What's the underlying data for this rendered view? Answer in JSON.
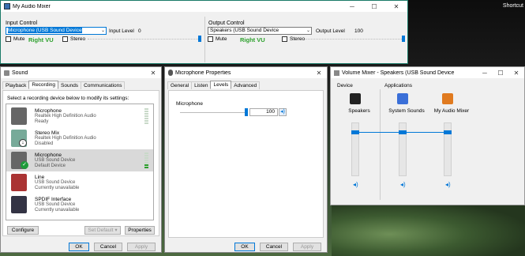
{
  "desktop": {
    "shortcut_label": "Shortcut"
  },
  "mixer": {
    "title": "My Audio Mixer",
    "input": {
      "group_label": "Input Control",
      "device_value": "Microphone (USB Sound Device",
      "level_label": "Input Level",
      "level_value": "0",
      "mute_label": "Mute",
      "vu_label": "Right VU",
      "stereo_label": "Stereo",
      "slider_fraction": 1.0
    },
    "output": {
      "group_label": "Output Control",
      "device_value": "Speakers (USB Sound Device",
      "level_label": "Output Level",
      "level_value": "100",
      "mute_label": "Mute",
      "vu_label": "Right VU",
      "stereo_label": "Stereo",
      "slider_fraction": 1.0
    },
    "controls": {
      "minimize": "─",
      "maximize": "☐",
      "close": "✕"
    }
  },
  "sound": {
    "title": "Sound",
    "close": "✕",
    "tabs": [
      "Playback",
      "Recording",
      "Sounds",
      "Communications"
    ],
    "active_tab": "Recording",
    "instruction": "Select a recording device below to modify its settings:",
    "devices": [
      {
        "name": "Microphone",
        "line1": "Realtek High Definition Audio",
        "line2": "Ready",
        "icon": "microphone-icon"
      },
      {
        "name": "Stereo Mix",
        "line1": "Realtek High Definition Audio",
        "line2": "Disabled",
        "icon": "stereo-mix-icon"
      },
      {
        "name": "Microphone",
        "line1": "USB Sound Device",
        "line2": "Default Device",
        "icon": "microphone-icon"
      },
      {
        "name": "Line",
        "line1": "USB Sound Device",
        "line2": "Currently unavailable",
        "icon": "line-in-icon"
      },
      {
        "name": "SPDIF Interface",
        "line1": "USB Sound Device",
        "line2": "Currently unavailable",
        "icon": "spdif-icon"
      }
    ],
    "buttons": {
      "configure": "Configure",
      "set_default": "Set Default",
      "properties": "Properties",
      "ok": "OK",
      "cancel": "Cancel",
      "apply": "Apply"
    }
  },
  "mic_props": {
    "title": "Microphone Properties",
    "close": "✕",
    "tabs": [
      "General",
      "Listen",
      "Levels",
      "Advanced"
    ],
    "active_tab": "Levels",
    "level_label": "Microphone",
    "level_value": "100",
    "level_fraction": 1.0,
    "buttons": {
      "ok": "OK",
      "cancel": "Cancel",
      "apply": "Apply"
    }
  },
  "volume_mixer": {
    "title": "Volume Mixer - Speakers (USB Sound Device",
    "controls": {
      "minimize": "─",
      "maximize": "☐",
      "close": "✕"
    },
    "device_header": "Device",
    "apps_header": "Applications",
    "columns": [
      {
        "label": "Speakers",
        "icon": "speaker-icon",
        "level": 0.85
      },
      {
        "label": "System Sounds",
        "icon": "system-sounds-icon",
        "level": 0.85
      },
      {
        "label": "My Audio Mixer",
        "icon": "app-icon",
        "level": 0.85
      }
    ]
  }
}
